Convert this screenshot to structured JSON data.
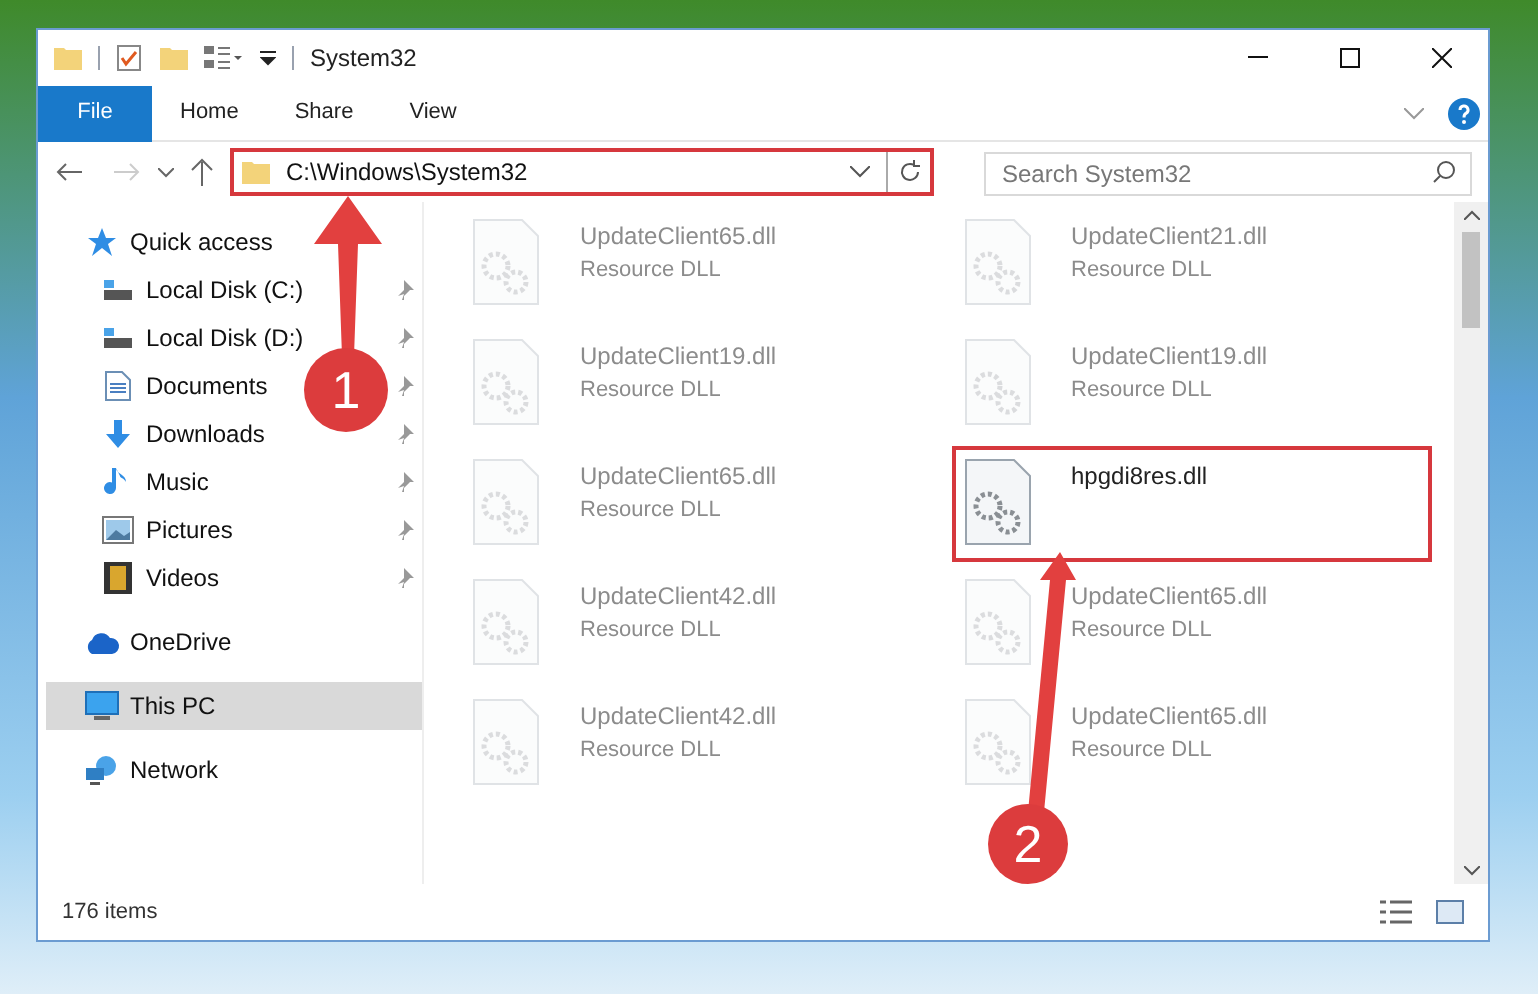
{
  "window": {
    "title": "System32"
  },
  "ribbon_tabs": [
    {
      "label": "File",
      "selected": true
    },
    {
      "label": "Home",
      "selected": false
    },
    {
      "label": "Share",
      "selected": false
    },
    {
      "label": "View",
      "selected": false
    }
  ],
  "address_bar": {
    "path": "C:\\Windows\\System32",
    "highlighted": true
  },
  "search": {
    "placeholder": "Search System32"
  },
  "sidebar": {
    "items": [
      {
        "label": "Quick access",
        "kind": "star",
        "selected": false,
        "children": [
          {
            "label": "Local Disk (C:)",
            "kind": "drive",
            "pinned": true,
            "selected": false
          },
          {
            "label": "Local Disk (D:)",
            "kind": "drive",
            "pinned": true,
            "selected": false
          },
          {
            "label": "Documents",
            "kind": "document",
            "pinned": true,
            "selected": false
          },
          {
            "label": "Downloads",
            "kind": "download",
            "pinned": true,
            "selected": false
          },
          {
            "label": "Music",
            "kind": "music",
            "pinned": true,
            "selected": false
          },
          {
            "label": "Pictures",
            "kind": "picture",
            "pinned": true,
            "selected": false
          },
          {
            "label": "Videos",
            "kind": "video",
            "pinned": true,
            "selected": false
          }
        ]
      },
      {
        "label": "OneDrive",
        "kind": "cloud",
        "selected": false
      },
      {
        "label": "This PC",
        "kind": "monitor",
        "selected": true
      },
      {
        "label": "Network",
        "kind": "network",
        "selected": false
      }
    ]
  },
  "files": [
    {
      "name": "UpdateClient65.dll",
      "type": "Resource DLL",
      "faded": true,
      "highlighted": false
    },
    {
      "name": "UpdateClient21.dll",
      "type": "Resource DLL",
      "faded": true,
      "highlighted": false
    },
    {
      "name": "UpdateClient19.dll",
      "type": "Resource DLL",
      "faded": true,
      "highlighted": false
    },
    {
      "name": "UpdateClient19.dll",
      "type": "Resource DLL",
      "faded": true,
      "highlighted": false
    },
    {
      "name": "UpdateClient65.dll",
      "type": "Resource DLL",
      "faded": true,
      "highlighted": false
    },
    {
      "name": "hpgdi8res.dll",
      "faded": false,
      "highlighted": true
    },
    {
      "name": "UpdateClient42.dll",
      "type": "Resource DLL",
      "faded": true,
      "highlighted": false
    },
    {
      "name": "UpdateClient65.dll",
      "type": "Resource DLL",
      "faded": true,
      "highlighted": false
    },
    {
      "name": "UpdateClient42.dll",
      "type": "Resource DLL",
      "faded": true,
      "highlighted": false
    },
    {
      "name": "UpdateClient65.dll",
      "type": "Resource DLL",
      "faded": true,
      "highlighted": false
    }
  ],
  "status_bar": {
    "item_count": "176 items"
  },
  "annotations": [
    {
      "number": "1"
    },
    {
      "number": "2"
    }
  ]
}
